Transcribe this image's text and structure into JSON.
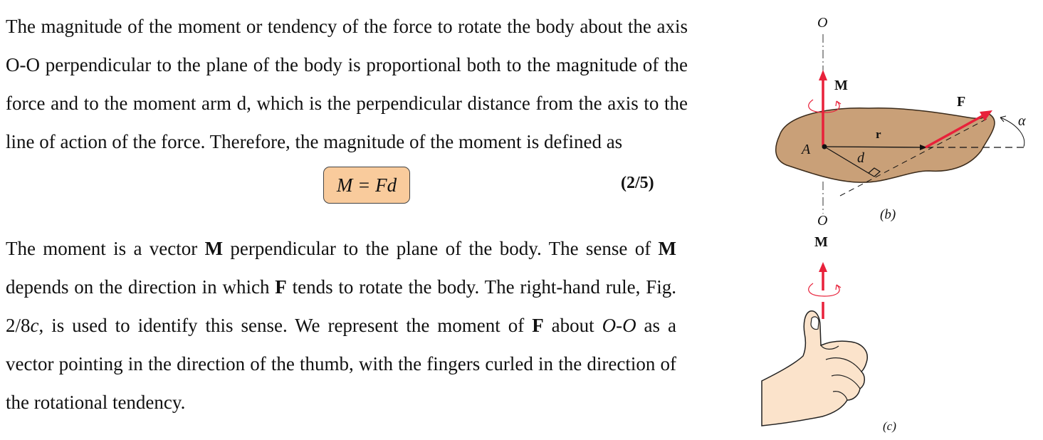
{
  "paragraph1": "The magnitude of the moment or tendency of the force to rotate the body about the axis O-O perpendicular to the plane of the body is proportional both to the magnitude of the force and to the moment arm d, which is the perpendicular distance from the axis to the line of action of the force. Therefore, the magnitude of the moment is defined as",
  "equation": {
    "text": "M = Fd",
    "number": "(2/5)",
    "box_color": "#f9cb9c"
  },
  "paragraph2": {
    "s1": "The moment is a vector ",
    "s2": "M",
    "s3": " perpendicular to the plane of the body. The sense of ",
    "s4": "M",
    "s5": " depends on the direction in which ",
    "s6": "F",
    "s7": " tends to rotate the body. The right-hand rule, Fig. 2/8",
    "s8": "c",
    "s9": ", is used to identify this sense. We represent the moment of ",
    "s10": "F",
    "s11": " about ",
    "s12": "O-O",
    "s13": " as a vector pointing in the direction of the thumb, with the fingers curled in the direction of the rotational tendency."
  },
  "figure": {
    "label_O_top": "O",
    "label_M_b": "M",
    "label_F": "F",
    "label_alpha": "α",
    "label_r": "r",
    "label_A": "A",
    "label_d": "d",
    "label_O_bottom": "O",
    "label_b": "(b)",
    "label_M_c": "M",
    "label_c": "(c)",
    "colors": {
      "vector_red": "#e8213a",
      "body_tan": "#c9a078",
      "skin": "#fbe3cb"
    }
  }
}
